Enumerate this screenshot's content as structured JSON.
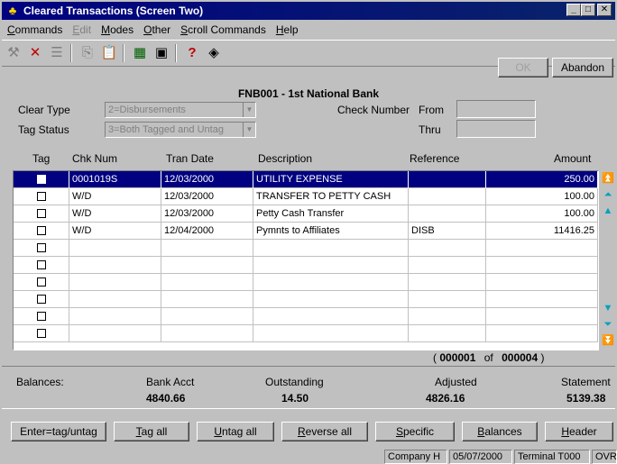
{
  "window": {
    "title": "Cleared Transactions (Screen Two)"
  },
  "menu": [
    {
      "label": "Commands",
      "ul": "C",
      "rest": "ommands",
      "disabled": false
    },
    {
      "label": "Edit",
      "ul": "E",
      "rest": "dit",
      "disabled": true
    },
    {
      "label": "Modes",
      "ul": "M",
      "rest": "odes",
      "disabled": false
    },
    {
      "label": "Other",
      "ul": "O",
      "rest": "ther",
      "disabled": false
    },
    {
      "label": "Scroll Commands",
      "ul": "S",
      "rest": "croll Commands",
      "disabled": false
    },
    {
      "label": "Help",
      "ul": "H",
      "rest": "elp",
      "disabled": false
    }
  ],
  "toolbar": {
    "ok_label": "OK",
    "abandon_label": "Abandon"
  },
  "header": {
    "bank": "FNB001 - 1st National Bank",
    "clear_type_label": "Clear Type",
    "clear_type_value": "2=Disbursements",
    "tag_status_label": "Tag Status",
    "tag_status_value": "3=Both Tagged and Untag",
    "check_number_label": "Check Number",
    "from_label": "From",
    "thru_label": "Thru"
  },
  "grid": {
    "columns": [
      "Tag",
      "Chk Num",
      "Tran Date",
      "Description",
      "Reference",
      "Amount"
    ],
    "rows": [
      {
        "chk": "0001019S",
        "date": "12/03/2000",
        "desc": "UTILITY EXPENSE",
        "ref": "",
        "amount": "250.00",
        "selected": true
      },
      {
        "chk": "W/D",
        "date": "12/03/2000",
        "desc": "TRANSFER TO PETTY CASH",
        "ref": "",
        "amount": "100.00",
        "selected": false
      },
      {
        "chk": "W/D",
        "date": "12/03/2000",
        "desc": "Petty Cash Transfer",
        "ref": "",
        "amount": "100.00",
        "selected": false
      },
      {
        "chk": "W/D",
        "date": "12/04/2000",
        "desc": "Pymnts to Affiliates",
        "ref": "DISB",
        "amount": "11416.25",
        "selected": false
      },
      {
        "chk": "",
        "date": "",
        "desc": "",
        "ref": "",
        "amount": "",
        "selected": false
      },
      {
        "chk": "",
        "date": "",
        "desc": "",
        "ref": "",
        "amount": "",
        "selected": false
      },
      {
        "chk": "",
        "date": "",
        "desc": "",
        "ref": "",
        "amount": "",
        "selected": false
      },
      {
        "chk": "",
        "date": "",
        "desc": "",
        "ref": "",
        "amount": "",
        "selected": false
      },
      {
        "chk": "",
        "date": "",
        "desc": "",
        "ref": "",
        "amount": "",
        "selected": false
      },
      {
        "chk": "",
        "date": "",
        "desc": "",
        "ref": "",
        "amount": "",
        "selected": false
      }
    ],
    "counter_open": "(",
    "counter_current": "000001",
    "counter_of": "of",
    "counter_total": "000004",
    "counter_close": ")"
  },
  "balances": {
    "label": "Balances:",
    "bank_acct_label": "Bank Acct",
    "bank_acct_value": "4840.66",
    "outstanding_label": "Outstanding",
    "outstanding_value": "14.50",
    "adjusted_label": "Adjusted",
    "adjusted_value": "4826.16",
    "statement_label": "Statement",
    "statement_value": "5139.38"
  },
  "buttons": [
    {
      "pre": "Enter=tag/untag",
      "ul": "",
      "rest": ""
    },
    {
      "pre": "",
      "ul": "T",
      "rest": "ag all"
    },
    {
      "pre": "",
      "ul": "U",
      "rest": "ntag all"
    },
    {
      "pre": "",
      "ul": "R",
      "rest": "everse all"
    },
    {
      "pre": "",
      "ul": "S",
      "rest": "pecific"
    },
    {
      "pre": "",
      "ul": "B",
      "rest": "alances"
    },
    {
      "pre": "",
      "ul": "H",
      "rest": "eader"
    }
  ],
  "status": {
    "company": "Company H",
    "date": "05/07/2000",
    "terminal": "Terminal T000",
    "mode": "OVR"
  },
  "colors": {
    "title_bar": "#000080",
    "selection": "#000080",
    "scroll_arrows": "#00a0c0"
  }
}
